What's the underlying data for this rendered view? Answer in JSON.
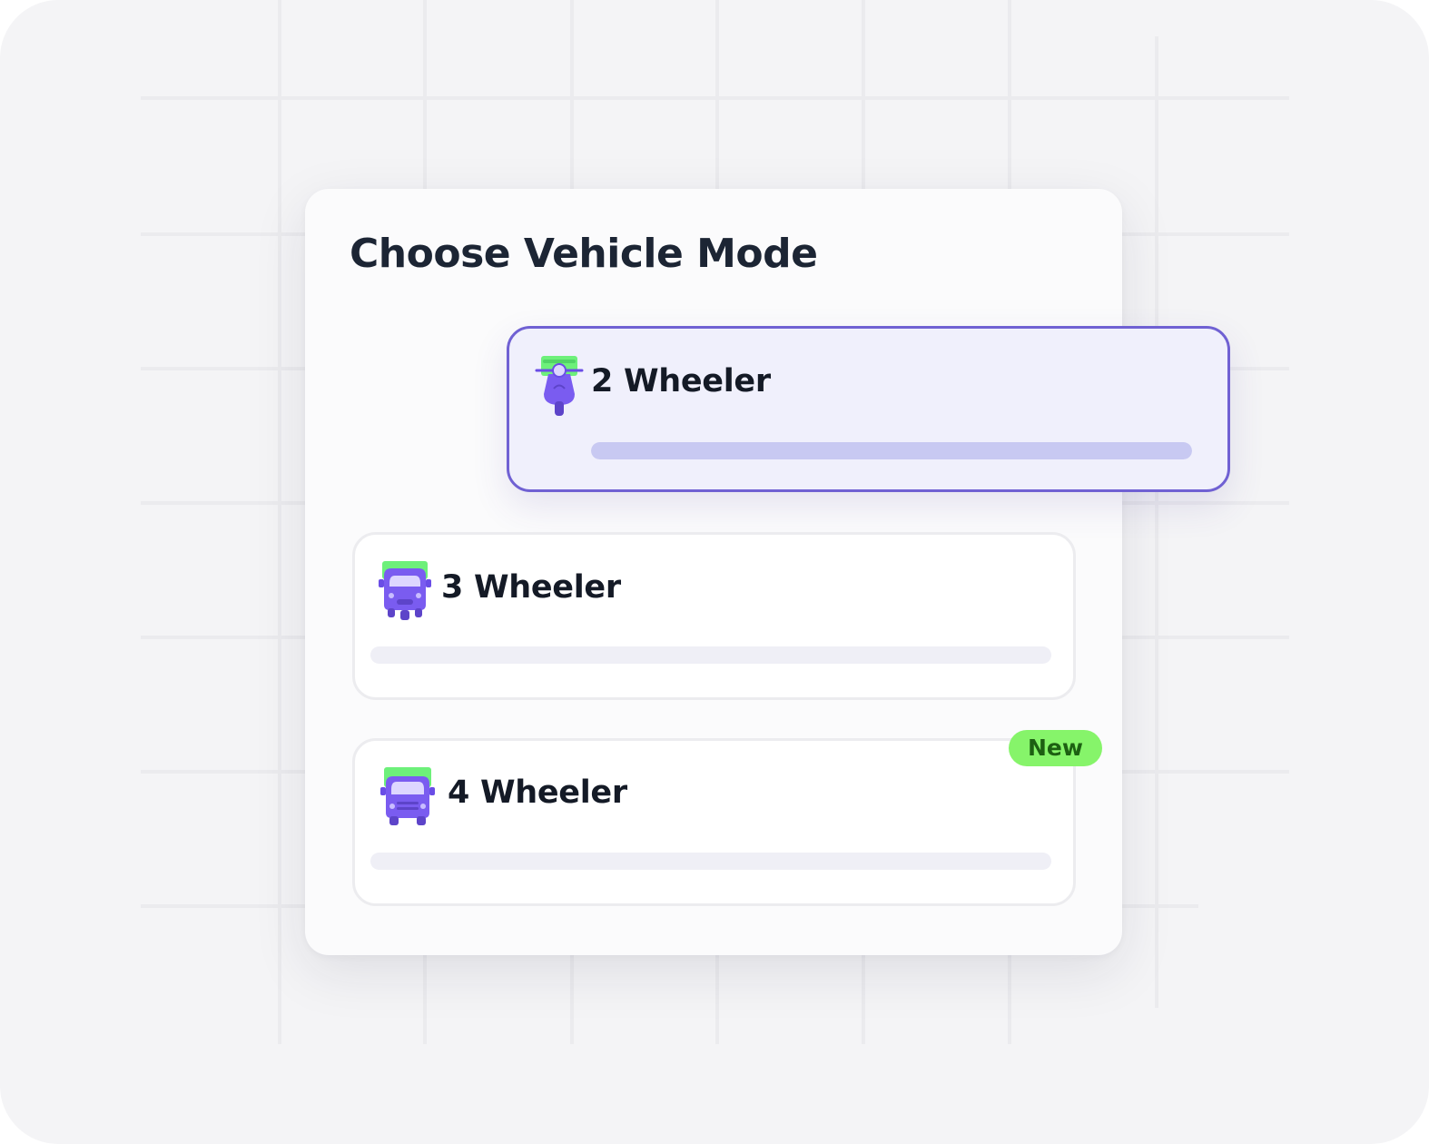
{
  "title": "Choose Vehicle Mode",
  "colors": {
    "selected_border": "#7061d3",
    "selected_background": "#f0f0fc",
    "selected_bar": "#c8c9f2",
    "idle_bar": "#efeff6",
    "badge_background": "#86f46a",
    "badge_text": "#1d6012",
    "vehicle_body": "#7a5cf0",
    "cargo_green": "#6df07a"
  },
  "options": [
    {
      "label": "2 Wheeler",
      "icon": "scooter-icon",
      "selected": true,
      "progress": 1.0
    },
    {
      "label": "3 Wheeler",
      "icon": "auto-rickshaw-icon",
      "selected": false,
      "progress": 1.0
    },
    {
      "label": "4 Wheeler",
      "icon": "mini-truck-icon",
      "selected": false,
      "progress": 1.0,
      "badge": "New"
    }
  ]
}
